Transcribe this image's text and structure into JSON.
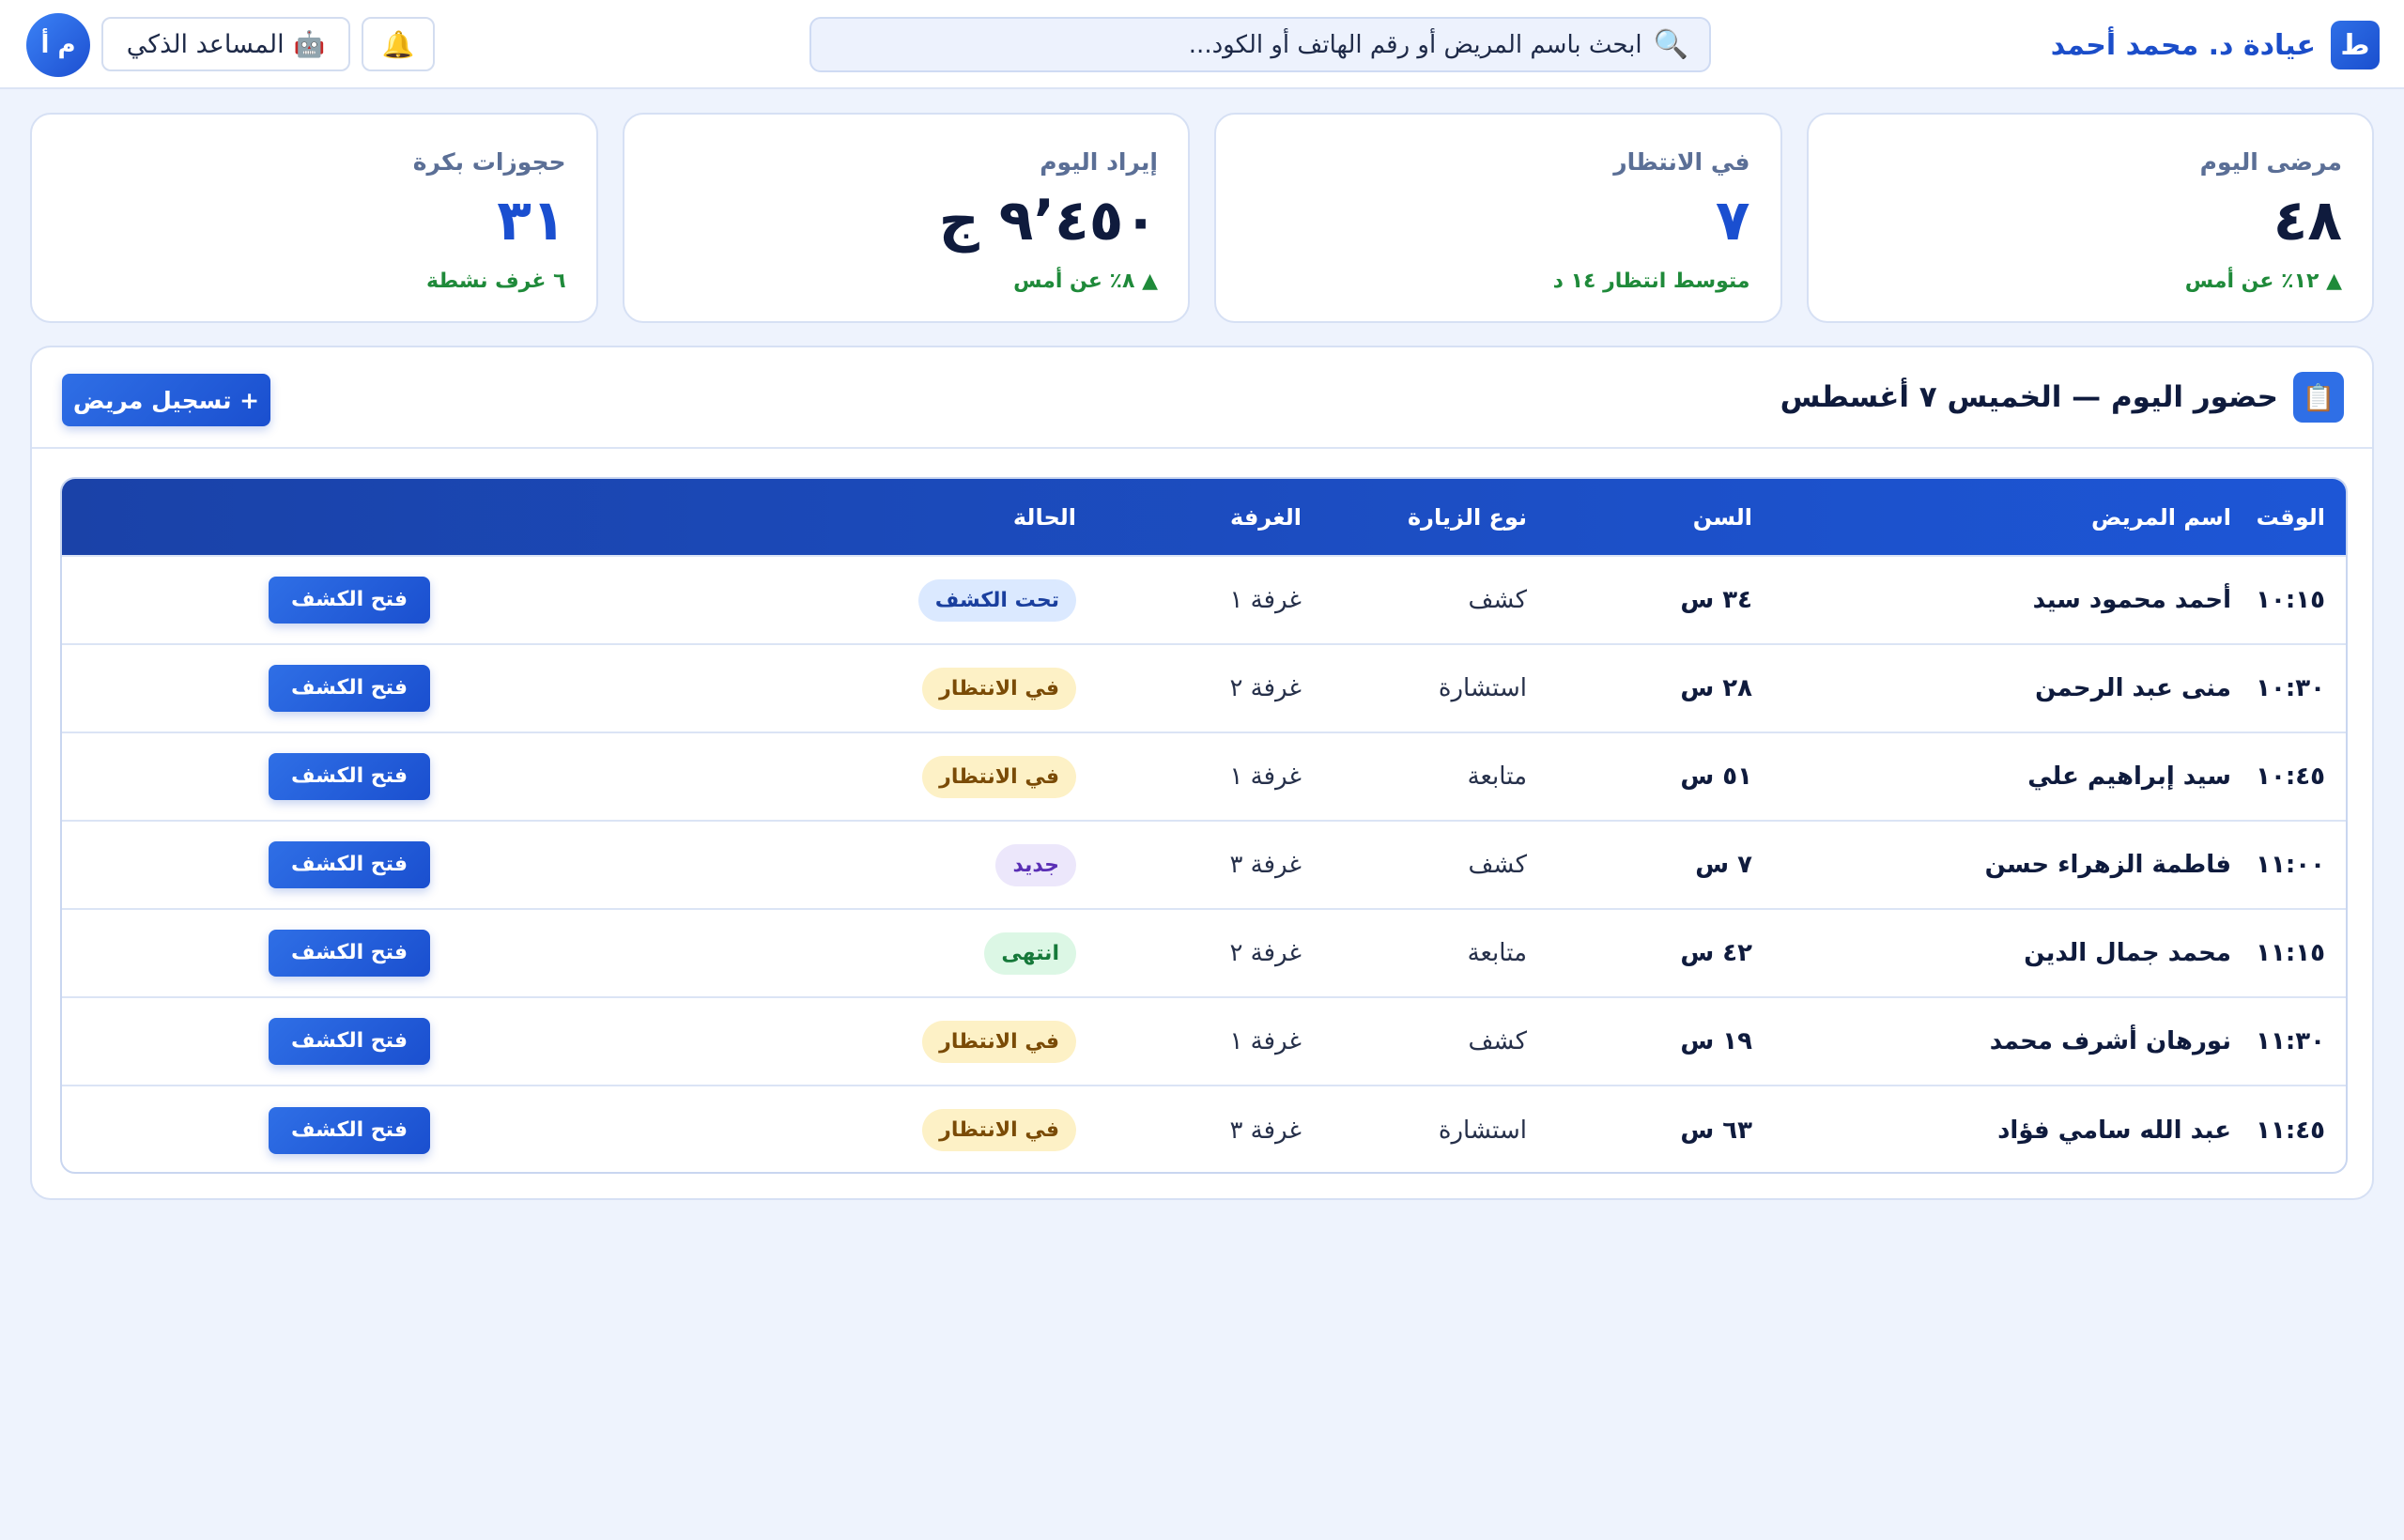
{
  "header": {
    "brand_logo": "ط",
    "brand_name": "عيادة د. محمد أحمد",
    "search_placeholder": "ابحث باسم المريض أو رقم الهاتف أو الكود...",
    "search_icon": "🔍",
    "assistant_label": "المساعد الذكي",
    "assistant_icon": "🤖",
    "bell_icon": "🔔",
    "avatar_initials": "م أ"
  },
  "stats": [
    {
      "label": "مرضى اليوم",
      "value": "٤٨",
      "note": "▲ ١٢٪ عن أمس",
      "color": "dark"
    },
    {
      "label": "في الانتظار",
      "value": "٧",
      "note": "متوسط انتظار ١٤ د",
      "color": "blue"
    },
    {
      "label": "إيراد اليوم",
      "value": "٩٬٤٥٠ ج",
      "note": "▲ ٨٪ عن أمس",
      "color": "dark"
    },
    {
      "label": "حجوزات بكرة",
      "value": "٣١",
      "note": "٦ غرف نشطة",
      "color": "blue"
    }
  ],
  "panel": {
    "title": "حضور اليوم — الخميس ٧ أغسطس",
    "title_icon": "📋",
    "register_label": "+ تسجيل مريض"
  },
  "table": {
    "columns": [
      "الوقت",
      "اسم المريض",
      "السن",
      "نوع الزيارة",
      "الغرفة",
      "الحالة",
      ""
    ],
    "rows": [
      {
        "time": "١٠:١٥",
        "name": "أحمد محمود سيد",
        "age": "٣٤ س",
        "visit": "كشف",
        "room": "غرفة ١",
        "status": "تحت الكشف",
        "status_type": "exam",
        "action": "فتح الكشف"
      },
      {
        "time": "١٠:٣٠",
        "name": "منى عبد الرحمن",
        "age": "٢٨ س",
        "visit": "استشارة",
        "room": "غرفة ٢",
        "status": "في الانتظار",
        "status_type": "wait",
        "action": "فتح الكشف"
      },
      {
        "time": "١٠:٤٥",
        "name": "سيد إبراهيم علي",
        "age": "٥١ س",
        "visit": "متابعة",
        "room": "غرفة ١",
        "status": "في الانتظار",
        "status_type": "wait",
        "action": "فتح الكشف"
      },
      {
        "time": "١١:٠٠",
        "name": "فاطمة الزهراء حسن",
        "age": "٧ س",
        "visit": "كشف",
        "room": "غرفة ٣",
        "status": "جديد",
        "status_type": "new",
        "action": "فتح الكشف"
      },
      {
        "time": "١١:١٥",
        "name": "محمد جمال الدين",
        "age": "٤٢ س",
        "visit": "متابعة",
        "room": "غرفة ٢",
        "status": "انتهى",
        "status_type": "done",
        "action": "فتح الكشف"
      },
      {
        "time": "١١:٣٠",
        "name": "نورهان أشرف محمد",
        "age": "١٩ س",
        "visit": "كشف",
        "room": "غرفة ١",
        "status": "في الانتظار",
        "status_type": "wait",
        "action": "فتح الكشف"
      },
      {
        "time": "١١:٤٥",
        "name": "عبد الله سامي فؤاد",
        "age": "٦٣ س",
        "visit": "استشارة",
        "room": "غرفة ٣",
        "status": "في الانتظار",
        "status_type": "wait",
        "action": "فتح الكشف"
      }
    ]
  },
  "colors": {
    "accent": "#1a4fd0",
    "background": "#eef3fd",
    "positive": "#1f8a3a"
  }
}
